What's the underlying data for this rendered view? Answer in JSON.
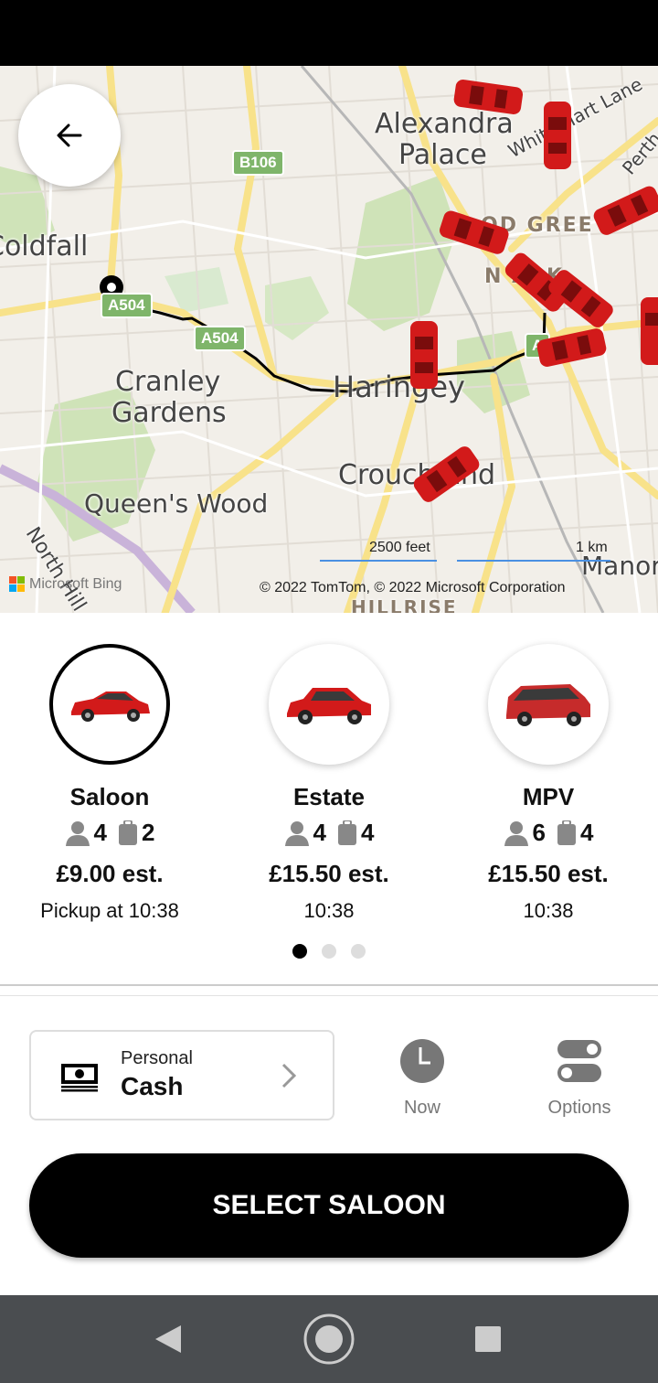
{
  "map": {
    "places": [
      {
        "id": "alexandra",
        "text": "Alexandra"
      },
      {
        "id": "palace",
        "text": "Palace"
      },
      {
        "id": "coldfall",
        "text": "Coldfall"
      },
      {
        "id": "cranley1",
        "text": "Cranley"
      },
      {
        "id": "cranley2",
        "text": "Gardens"
      },
      {
        "id": "haringey",
        "text": "Haringey"
      },
      {
        "id": "crouch",
        "text": "Crouch End"
      },
      {
        "id": "queens",
        "text": "Queen's Wood"
      },
      {
        "id": "northhill",
        "text": "North Hill"
      },
      {
        "id": "woodgreen",
        "text": "OD GREE"
      },
      {
        "id": "npark",
        "text": "N    ARK"
      },
      {
        "id": "whitehart",
        "text": "White Hart Lane"
      },
      {
        "id": "perth",
        "text": "Perth"
      },
      {
        "id": "manor",
        "text": "Manor"
      },
      {
        "id": "hillrise",
        "text": "HILLRISE"
      }
    ],
    "roads": {
      "b106": "B106",
      "a504a": "A504",
      "a504b": "A504",
      "a5": "A"
    },
    "scale_feet": "2500 feet",
    "scale_km": "1 km",
    "copyright": "© 2022 TomTom, © 2022 Microsoft Corporation",
    "bing": "Microsoft Bing",
    "bing_colors": [
      "#f35325",
      "#81bc06",
      "#05a6f0",
      "#ffba08"
    ],
    "car_color": "#d21a1a"
  },
  "vehicles": [
    {
      "name": "Saloon",
      "passengers": "4",
      "luggage": "2",
      "price": "£9.00 est.",
      "time": "Pickup at 10:38",
      "selected": true,
      "color": "#d21a1a"
    },
    {
      "name": "Estate",
      "passengers": "4",
      "luggage": "4",
      "price": "£15.50 est.",
      "time": "10:38",
      "selected": false,
      "color": "#d21a1a"
    },
    {
      "name": "MPV",
      "passengers": "6",
      "luggage": "4",
      "price": "£15.50 est.",
      "time": "10:38",
      "selected": false,
      "color": "#c62b2b"
    }
  ],
  "pagination": {
    "pages": 3,
    "active": 0
  },
  "payment": {
    "type": "Personal",
    "method": "Cash"
  },
  "actions": {
    "now": "Now",
    "options": "Options"
  },
  "select_button": "SELECT SALOON"
}
